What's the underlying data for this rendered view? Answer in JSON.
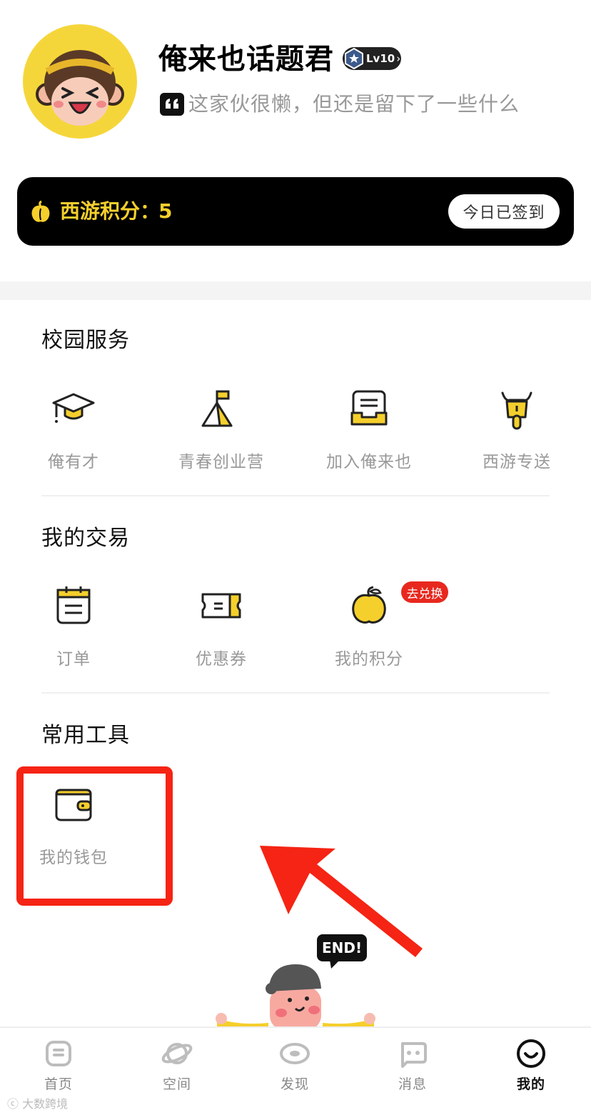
{
  "profile": {
    "username": "俺来也话题君",
    "level": "Lv10",
    "bio": "这家伙很懒，但还是留下了一些什么"
  },
  "points": {
    "label": "西游积分：",
    "value": "5",
    "signin_button": "今日已签到"
  },
  "campus_services": {
    "title": "校园服务",
    "items": [
      {
        "label": "俺有才",
        "icon": "graduation-cap-icon"
      },
      {
        "label": "青春创业营",
        "icon": "tent-flag-icon"
      },
      {
        "label": "加入俺来也",
        "icon": "document-tray-icon"
      },
      {
        "label": "西游专送",
        "icon": "scooter-icon"
      }
    ]
  },
  "my_trades": {
    "title": "我的交易",
    "items": [
      {
        "label": "订单",
        "icon": "calendar-list-icon"
      },
      {
        "label": "优惠券",
        "icon": "coupon-icon"
      },
      {
        "label": "我的积分",
        "icon": "peach-icon",
        "badge": "去兑换"
      }
    ]
  },
  "tools": {
    "title": "常用工具",
    "items": [
      {
        "label": "我的钱包",
        "icon": "wallet-icon"
      }
    ]
  },
  "end_bubble": "END!",
  "nav": [
    {
      "label": "首页",
      "icon": "home-icon",
      "active": false
    },
    {
      "label": "空间",
      "icon": "planet-icon",
      "active": false
    },
    {
      "label": "发现",
      "icon": "eye-icon",
      "active": false
    },
    {
      "label": "消息",
      "icon": "chat-icon",
      "active": false
    },
    {
      "label": "我的",
      "icon": "smile-face-icon",
      "active": true
    }
  ],
  "watermark": "大数跨境",
  "colors": {
    "accent_yellow": "#F5CF2C",
    "highlight_red": "#F52414",
    "badge_red": "#E8281E"
  }
}
